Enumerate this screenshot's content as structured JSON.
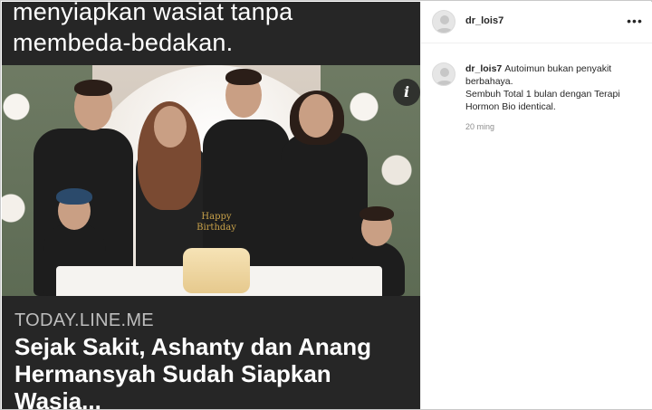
{
  "post": {
    "top_caption": "menyiapkan wasiat tanpa membeda-bedakan.",
    "info_badge": "i",
    "photo": {
      "cake_topper": "Happy Birthday"
    },
    "link": {
      "domain": "TODAY.LINE.ME",
      "title": "Sejak Sakit, Ashanty dan Anang Hermansyah Sudah Siapkan Wasia..."
    }
  },
  "sidebar": {
    "header": {
      "username": "dr_lois7",
      "more_icon": "more-horizontal-icon"
    },
    "comment": {
      "username": "dr_lois7",
      "line1": "Autoimun bukan penyakit berbahaya.",
      "line2": "Sembuh Total 1 bulan dengan Terapi Hormon Bio identical.",
      "timestamp": "20 ming"
    }
  },
  "colors": {
    "media_bg": "#262626",
    "text_primary": "#262626",
    "text_secondary": "#8e8e8e",
    "border": "#efefef"
  }
}
